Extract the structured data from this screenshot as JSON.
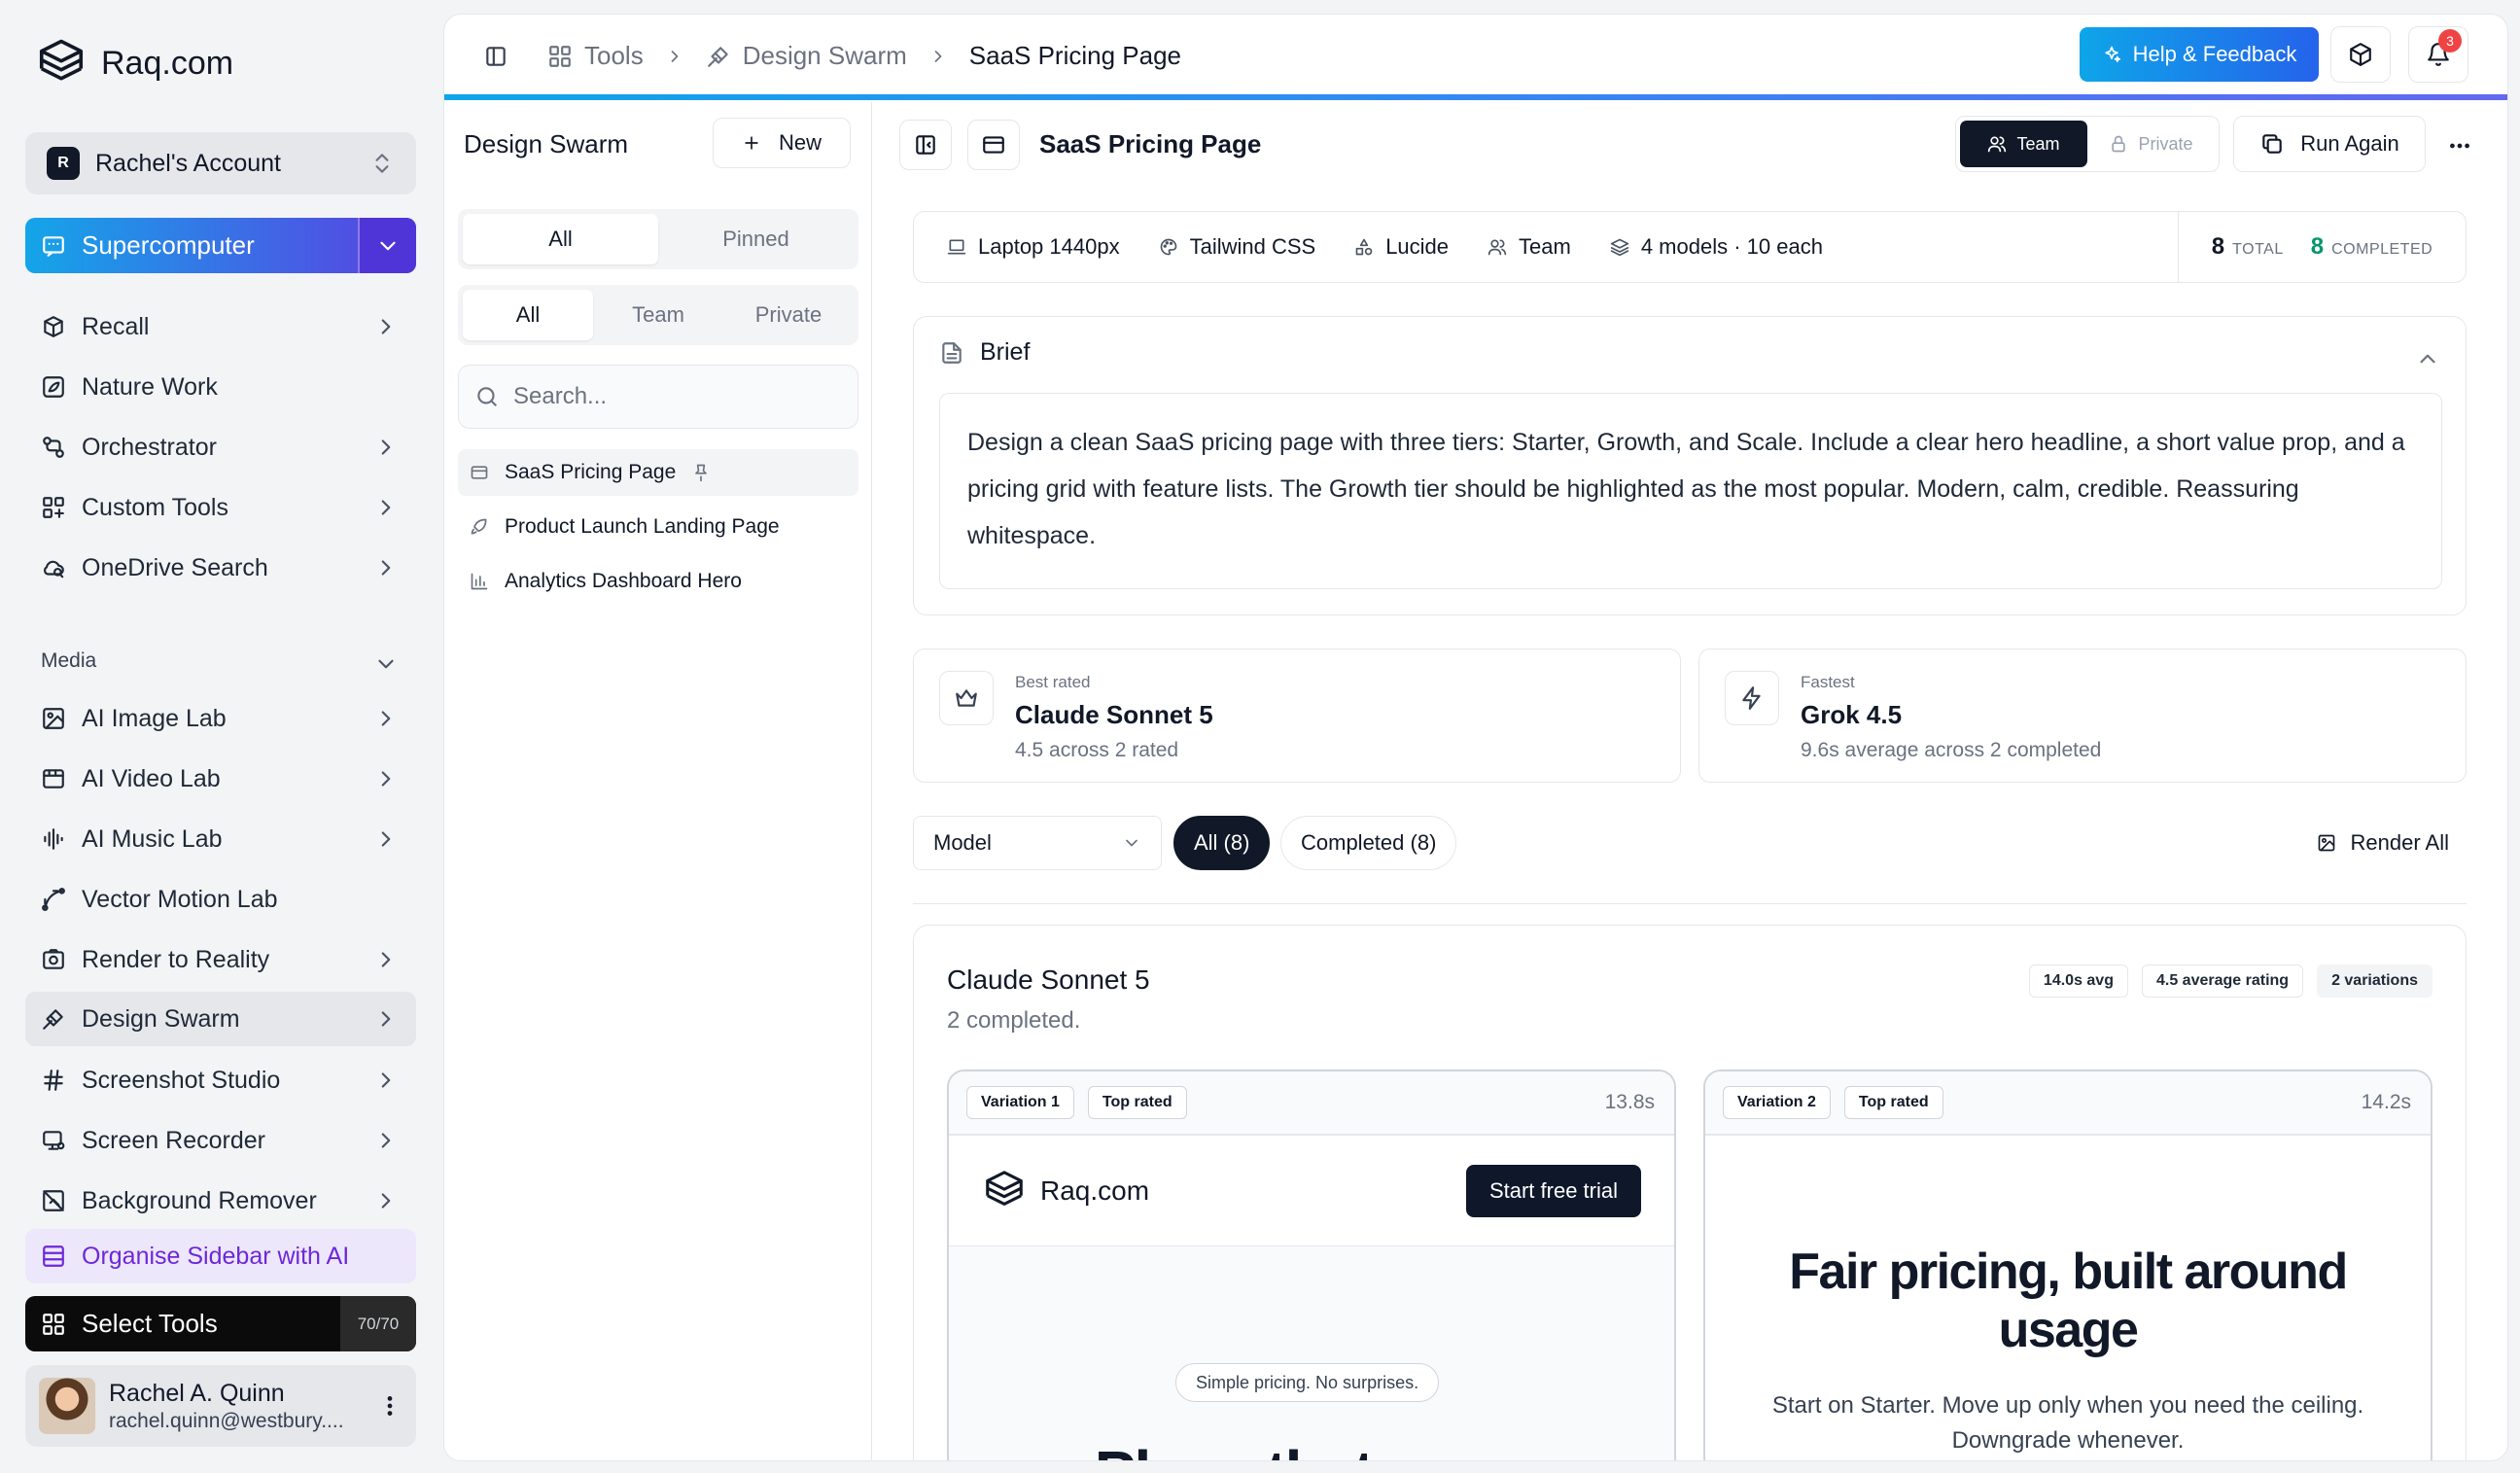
{
  "sidebar": {
    "brand": "Raq.com",
    "account": {
      "avatar": "R",
      "name": "Rachel's Account"
    },
    "supercomputer": "Supercomputer",
    "items": [
      {
        "label": "Recall",
        "icon": "recall-icon",
        "arrow": true
      },
      {
        "label": "Nature Work",
        "icon": "nature-icon",
        "arrow": false
      },
      {
        "label": "Orchestrator",
        "icon": "orchestrator-icon",
        "arrow": true
      },
      {
        "label": "Custom Tools",
        "icon": "custom-tools-icon",
        "arrow": true
      },
      {
        "label": "OneDrive Search",
        "icon": "onedrive-icon",
        "arrow": true
      }
    ],
    "media_label": "Media",
    "media_items": [
      {
        "label": "AI Image Lab",
        "icon": "image-icon",
        "arrow": true
      },
      {
        "label": "AI Video Lab",
        "icon": "video-icon",
        "arrow": true
      },
      {
        "label": "AI Music Lab",
        "icon": "music-icon",
        "arrow": true
      },
      {
        "label": "Vector Motion Lab",
        "icon": "vector-icon",
        "arrow": false
      },
      {
        "label": "Render to Reality",
        "icon": "render-icon",
        "arrow": true
      },
      {
        "label": "Design Swarm",
        "icon": "design-swarm-icon",
        "arrow": true,
        "active": true
      },
      {
        "label": "Screenshot Studio",
        "icon": "hash-icon",
        "arrow": true
      },
      {
        "label": "Screen Recorder",
        "icon": "screen-recorder-icon",
        "arrow": true
      },
      {
        "label": "Background Remover",
        "icon": "background-remover-icon",
        "arrow": true
      }
    ],
    "organise": "Organise Sidebar with AI",
    "select_tools": "Select Tools",
    "select_count": "70/70",
    "user": {
      "name": "Rachel A. Quinn",
      "email": "rachel.quinn@westbury...."
    }
  },
  "topbar": {
    "breadcrumbs": [
      "Tools",
      "Design Swarm",
      "SaaS Pricing Page"
    ],
    "help": "Help & Feedback",
    "notifications": "3"
  },
  "left_panel": {
    "title": "Design Swarm",
    "new_label": "New",
    "tabs1": [
      "All",
      "Pinned"
    ],
    "tabs2": [
      "All",
      "Team",
      "Private"
    ],
    "search_placeholder": "Search...",
    "docs": [
      "SaaS Pricing Page",
      "Product Launch Landing Page",
      "Analytics Dashboard Hero"
    ]
  },
  "content": {
    "title": "SaaS Pricing Page",
    "team": "Team",
    "private": "Private",
    "run_again": "Run Again",
    "meta": [
      "Laptop 1440px",
      "Tailwind CSS",
      "Lucide",
      "Team",
      "4 models · 10 each"
    ],
    "total_n": "8",
    "total_l": "TOTAL",
    "completed_n": "8",
    "completed_l": "COMPLETED",
    "brief_title": "Brief",
    "brief_text": "Design a clean SaaS pricing page with three tiers: Starter, Growth, and Scale. Include a clear hero headline, a short value prop, and a pricing grid with feature lists. The Growth tier should be highlighted as the most popular. Modern, calm, credible. Reassuring whitespace.",
    "best": {
      "k": "Best rated",
      "v": "Claude Sonnet 5",
      "d": "4.5 across 2 rated"
    },
    "fastest": {
      "k": "Fastest",
      "v": "Grok 4.5",
      "d": "9.6s average across 2 completed"
    },
    "model_select": "Model",
    "pill_all": "All (8)",
    "pill_completed": "Completed (8)",
    "render_all": "Render All",
    "group": {
      "title": "Claude Sonnet 5",
      "sub": "2 completed.",
      "chips": [
        "14.0s avg",
        "4.5 average rating",
        "2 variations"
      ],
      "v1": {
        "label": "Variation 1",
        "tag": "Top rated",
        "time": "13.8s",
        "brand": "Raq.com",
        "cta": "Start free trial",
        "pill": "Simple pricing. No surprises.",
        "headline": "Plans that grow"
      },
      "v2": {
        "label": "Variation 2",
        "tag": "Top rated",
        "time": "14.2s",
        "headline": "Fair pricing, built around usage",
        "sub": "Start on Starter. Move up only when you need the ceiling. Downgrade whenever."
      }
    }
  }
}
